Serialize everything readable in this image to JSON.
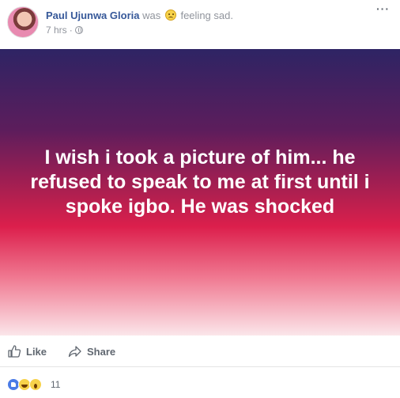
{
  "post": {
    "author": "Paul Ujunwa Gloria",
    "was": "was",
    "feeling": "feeling sad.",
    "time": "7 hrs",
    "dot": "·",
    "more": "···",
    "status": "I wish i took a picture of him... he refused to speak to me at first until i spoke igbo. He was shocked",
    "background_gradient": [
      "#2e2464",
      "#dc1f4c",
      "#fbe6ea"
    ]
  },
  "actions": {
    "like_label": "Like",
    "share_label": "Share"
  },
  "reactions": {
    "icons": [
      "like-icon",
      "haha-icon",
      "wow-icon"
    ],
    "count": "11"
  },
  "colors": {
    "name": "#365899",
    "muted": "#90949c",
    "action": "#606770"
  }
}
